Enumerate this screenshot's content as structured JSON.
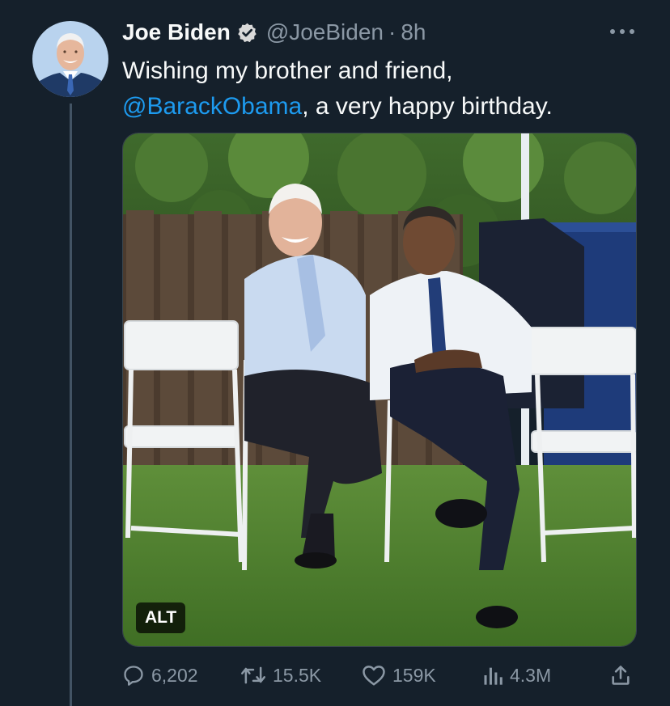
{
  "tweet": {
    "author_name": "Joe Biden",
    "handle": "@JoeBiden",
    "separator": "·",
    "time": "8h",
    "text_line1": "Wishing my brother and friend,",
    "mention": "@BarackObama",
    "text_line2_rest": ", a very happy birthday.",
    "media_alt_badge": "ALT"
  },
  "actions": {
    "replies": "6,202",
    "retweets": "15.5K",
    "likes": "159K",
    "views": "4.3M"
  },
  "icons": {
    "verified": "verified-badge-icon",
    "more": "more-dots-icon",
    "reply": "reply-icon",
    "retweet": "retweet-icon",
    "like": "heart-icon",
    "views": "analytics-icon",
    "share": "share-icon"
  },
  "colors": {
    "background": "#15202b",
    "accent": "#1d9bf0",
    "secondary_text": "#8b98a5",
    "thread_line": "#425364"
  }
}
